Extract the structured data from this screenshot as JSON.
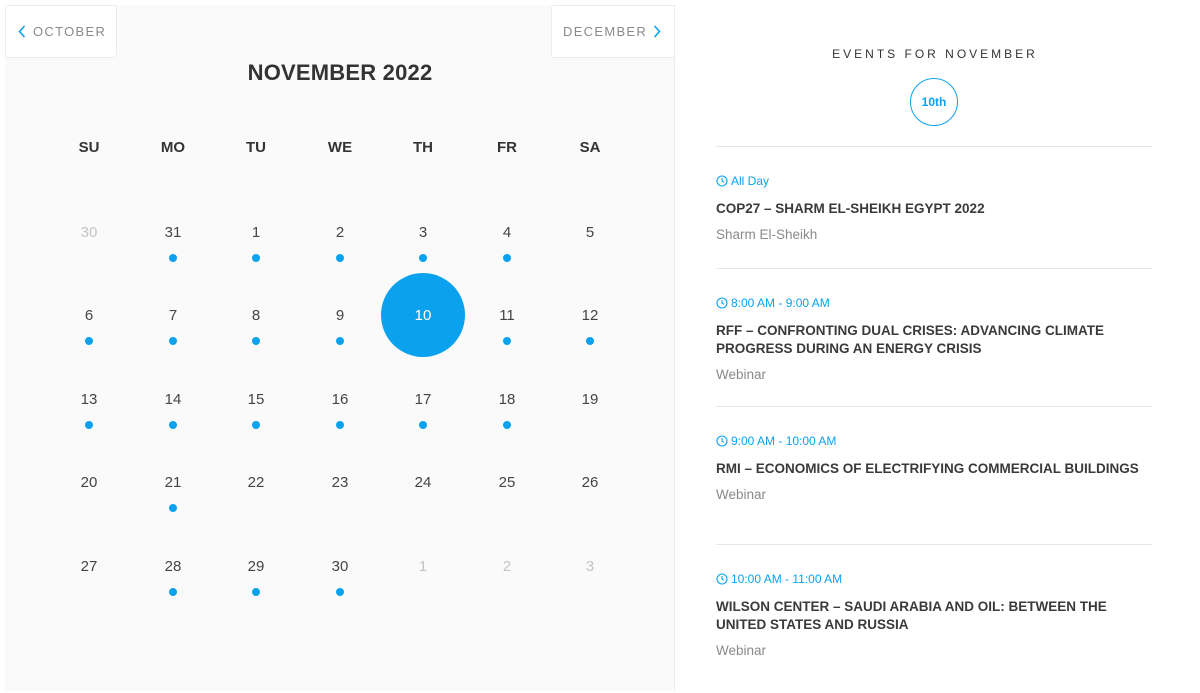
{
  "calendar": {
    "prev_label": "OCTOBER",
    "next_label": "DECEMBER",
    "month_title": "NOVEMBER 2022",
    "weekdays": [
      "SU",
      "MO",
      "TU",
      "WE",
      "TH",
      "FR",
      "SA"
    ],
    "accent_color": "#0aa2ee",
    "selected_day": "10",
    "weeks": [
      [
        {
          "n": "30",
          "muted": true,
          "event": false
        },
        {
          "n": "31",
          "muted": false,
          "event": true
        },
        {
          "n": "1",
          "muted": false,
          "event": true
        },
        {
          "n": "2",
          "muted": false,
          "event": true
        },
        {
          "n": "3",
          "muted": false,
          "event": true
        },
        {
          "n": "4",
          "muted": false,
          "event": true
        },
        {
          "n": "5",
          "muted": false,
          "event": false
        }
      ],
      [
        {
          "n": "6",
          "muted": false,
          "event": true
        },
        {
          "n": "7",
          "muted": false,
          "event": true
        },
        {
          "n": "8",
          "muted": false,
          "event": true
        },
        {
          "n": "9",
          "muted": false,
          "event": true
        },
        {
          "n": "10",
          "muted": false,
          "event": false
        },
        {
          "n": "11",
          "muted": false,
          "event": true
        },
        {
          "n": "12",
          "muted": false,
          "event": true
        }
      ],
      [
        {
          "n": "13",
          "muted": false,
          "event": true
        },
        {
          "n": "14",
          "muted": false,
          "event": true
        },
        {
          "n": "15",
          "muted": false,
          "event": true
        },
        {
          "n": "16",
          "muted": false,
          "event": true
        },
        {
          "n": "17",
          "muted": false,
          "event": true
        },
        {
          "n": "18",
          "muted": false,
          "event": true
        },
        {
          "n": "19",
          "muted": false,
          "event": false
        }
      ],
      [
        {
          "n": "20",
          "muted": false,
          "event": false
        },
        {
          "n": "21",
          "muted": false,
          "event": true
        },
        {
          "n": "22",
          "muted": false,
          "event": false
        },
        {
          "n": "23",
          "muted": false,
          "event": false
        },
        {
          "n": "24",
          "muted": false,
          "event": false
        },
        {
          "n": "25",
          "muted": false,
          "event": false
        },
        {
          "n": "26",
          "muted": false,
          "event": false
        }
      ],
      [
        {
          "n": "27",
          "muted": false,
          "event": false
        },
        {
          "n": "28",
          "muted": false,
          "event": true
        },
        {
          "n": "29",
          "muted": false,
          "event": true
        },
        {
          "n": "30",
          "muted": false,
          "event": true
        },
        {
          "n": "1",
          "muted": true,
          "event": false
        },
        {
          "n": "2",
          "muted": true,
          "event": false
        },
        {
          "n": "3",
          "muted": true,
          "event": false
        }
      ]
    ]
  },
  "events_panel": {
    "heading": "EVENTS FOR NOVEMBER",
    "date_badge": "10th",
    "events": [
      {
        "time": "All Day",
        "title": "COP27 – SHARM EL-SHEIKH EGYPT 2022",
        "location": "Sharm El-Sheikh"
      },
      {
        "time": "8:00 AM - 9:00 AM",
        "title": "RFF – CONFRONTING DUAL CRISES: ADVANCING CLIMATE PROGRESS DURING AN ENERGY CRISIS",
        "location": "Webinar"
      },
      {
        "time": "9:00 AM - 10:00 AM",
        "title": "RMI – ECONOMICS OF ELECTRIFYING COMMERCIAL BUILDINGS",
        "location": "Webinar"
      },
      {
        "time": "10:00 AM - 11:00 AM",
        "title": "WILSON CENTER – SAUDI ARABIA AND OIL: BETWEEN THE UNITED STATES AND RUSSIA",
        "location": "Webinar"
      }
    ]
  }
}
